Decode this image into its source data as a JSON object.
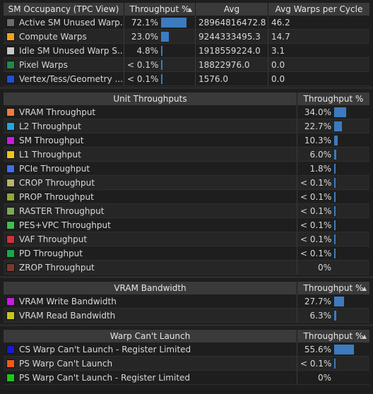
{
  "sm_occupancy": {
    "headers": [
      "SM Occupancy (TPC View)",
      "Throughput %",
      "Avg",
      "Avg Warps per Cycle"
    ],
    "rows": [
      {
        "label": "Active SM Unused Warp Slots",
        "display": "Active SM Unused Warp...",
        "color": "#6b6b6b",
        "throughput": "72.1%",
        "bar": 72.1,
        "avg": "28964816472.8",
        "warps": "46.2"
      },
      {
        "label": "Compute Warps",
        "display": "Compute Warps",
        "color": "#f4a11b",
        "throughput": "23.0%",
        "bar": 23.0,
        "avg": "9244333495.3",
        "warps": "14.7"
      },
      {
        "label": "Idle SM Unused Warp Slots",
        "display": "Idle SM Unused Warp S...",
        "color": "#c8c8c8",
        "throughput": "4.8%",
        "bar": 4.8,
        "avg": "1918559224.0",
        "warps": "3.1"
      },
      {
        "label": "Pixel Warps",
        "display": "Pixel Warps",
        "color": "#1e8a48",
        "throughput": "< 0.1%",
        "bar": 0.1,
        "avg": "18822976.0",
        "warps": "0.0"
      },
      {
        "label": "Vertex/Tess/Geometry Warps",
        "display": "Vertex/Tess/Geometry ...",
        "color": "#1f4fd6",
        "throughput": "< 0.1%",
        "bar": 0.1,
        "avg": "1576.0",
        "warps": "0.0"
      }
    ]
  },
  "unit_throughputs": {
    "headers": [
      "Unit Throughputs",
      "Throughput %"
    ],
    "rows": [
      {
        "label": "VRAM Throughput",
        "color": "#ef7c3a",
        "throughput": "34.0%",
        "bar": 34.0
      },
      {
        "label": "L2 Throughput",
        "color": "#1ea8e0",
        "throughput": "22.7%",
        "bar": 22.7
      },
      {
        "label": "SM Throughput",
        "color": "#c81ce0",
        "throughput": "10.3%",
        "bar": 10.3
      },
      {
        "label": "L1 Throughput",
        "color": "#f2c21a",
        "throughput": "6.0%",
        "bar": 6.0
      },
      {
        "label": "PCIe Throughput",
        "color": "#3e6ff0",
        "throughput": "1.8%",
        "bar": 1.8
      },
      {
        "label": "CROP Throughput",
        "color": "#b6b56a",
        "throughput": "< 0.1%",
        "bar": 0.1
      },
      {
        "label": "PROP Throughput",
        "color": "#8fa83a",
        "throughput": "< 0.1%",
        "bar": 0.1
      },
      {
        "label": "RASTER Throughput",
        "color": "#7fa85a",
        "throughput": "< 0.1%",
        "bar": 0.1
      },
      {
        "label": "PES+VPC Throughput",
        "color": "#3fbf4e",
        "throughput": "< 0.1%",
        "bar": 0.1
      },
      {
        "label": "VAF Throughput",
        "color": "#d0303c",
        "throughput": "< 0.1%",
        "bar": 0.1
      },
      {
        "label": "PD Throughput",
        "color": "#1aa84a",
        "throughput": "< 0.1%",
        "bar": 0.1
      },
      {
        "label": "ZROP Throughput",
        "color": "#7a3a2e",
        "throughput": "0%",
        "bar": 0
      }
    ]
  },
  "vram_bandwidth": {
    "headers": [
      "VRAM Bandwidth",
      "Throughput %"
    ],
    "rows": [
      {
        "label": "VRAM Write Bandwidth",
        "color": "#c81ce0",
        "throughput": "27.7%",
        "bar": 27.7
      },
      {
        "label": "VRAM Read Bandwidth",
        "color": "#c8c81a",
        "throughput": "6.3%",
        "bar": 6.3
      }
    ]
  },
  "warp_cant_launch": {
    "headers": [
      "Warp Can't Launch",
      "Throughput %"
    ],
    "rows": [
      {
        "label": "CS Warp Can't Launch - Register Limited",
        "color": "#1a1ad0",
        "throughput": "55.6%",
        "bar": 55.6
      },
      {
        "label": "PS Warp Can't Launch",
        "color": "#f05a1a",
        "throughput": "< 0.1%",
        "bar": 0.1
      },
      {
        "label": "PS Warp Can't Launch - Register Limited",
        "color": "#1ac81a",
        "throughput": "0%",
        "bar": 0
      }
    ]
  },
  "icons": {
    "sort": "sort-ascending-icon"
  }
}
